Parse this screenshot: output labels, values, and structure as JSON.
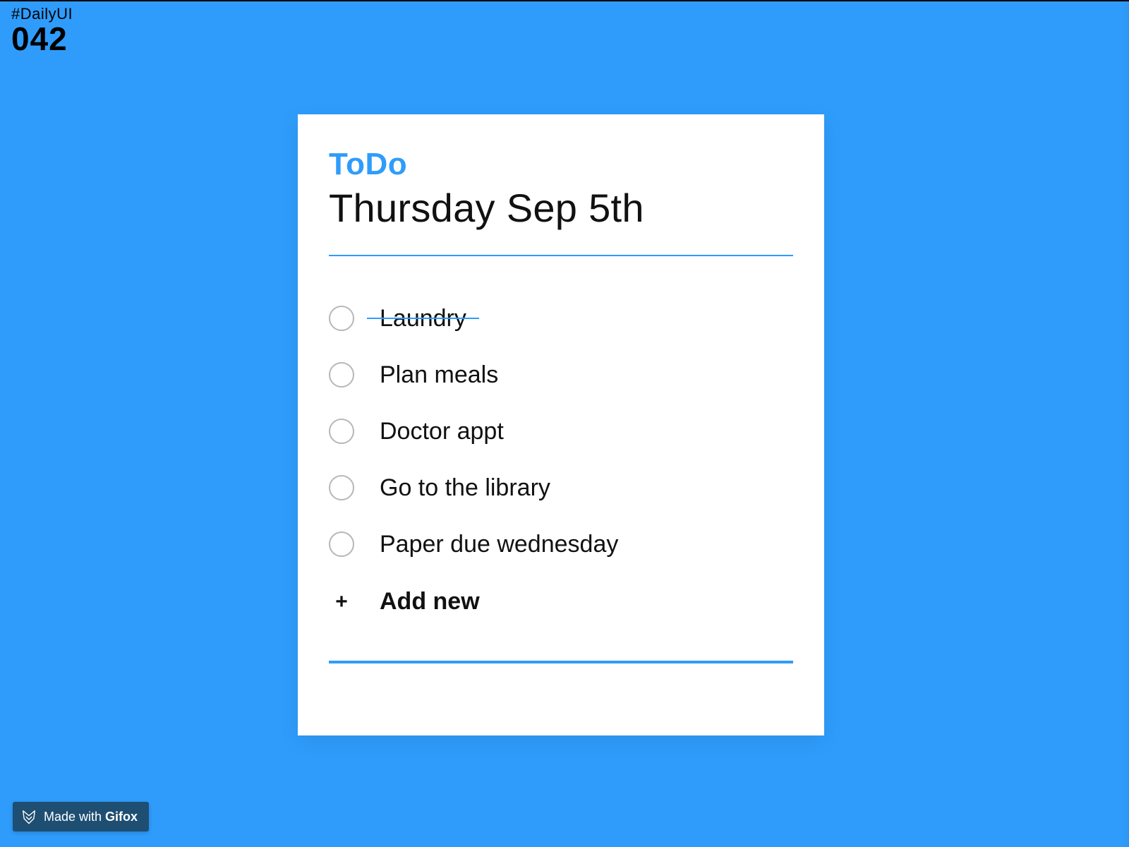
{
  "meta": {
    "hashtag": "#DailyUI",
    "challenge_number": "042"
  },
  "card": {
    "app_title": "ToDo",
    "date_title": "Thursday Sep 5th",
    "add_new_label": "Add new",
    "items": [
      {
        "label": "Laundry",
        "done": true
      },
      {
        "label": "Plan meals",
        "done": false
      },
      {
        "label": "Doctor appt",
        "done": false
      },
      {
        "label": "Go to the library",
        "done": false
      },
      {
        "label": "Paper due wednesday",
        "done": false
      }
    ]
  },
  "badge": {
    "prefix": "Made with ",
    "brand": "Gifox"
  },
  "colors": {
    "accent": "#2f9cfb",
    "badge_bg": "#1e4e72"
  }
}
